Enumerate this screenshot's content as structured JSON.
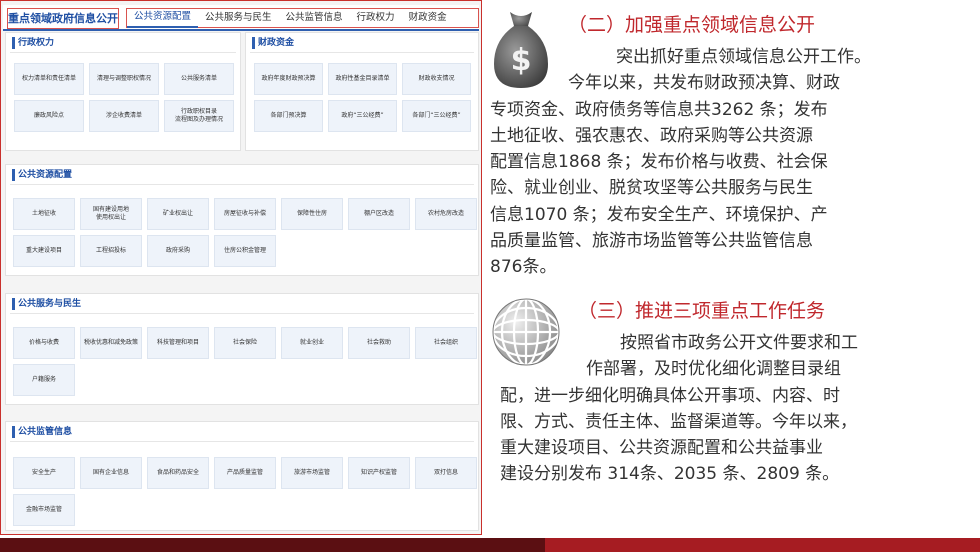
{
  "left_panel": {
    "site_title": "重点领域政府信息公开",
    "tabs": [
      "公共资源配置",
      "公共服务与民生",
      "公共监管信息",
      "行政权力",
      "财政资金"
    ],
    "active_tab": 0,
    "sections": {
      "admin_power": {
        "title": "行政权力",
        "items": [
          "权力清单和责任清单",
          "清理与调整职权情况",
          "公共服务清单",
          "廉政风险点",
          "涉企收费清单",
          "行政职权目录\n流程图及办理情况"
        ]
      },
      "fiscal": {
        "title": "财政资金",
        "items": [
          "政府年度财政预决算",
          "政府性基金目录清单",
          "财政收支情况",
          "各部门预决算",
          "政府“三公经费”",
          "各部门“三公经费”"
        ]
      },
      "resources": {
        "title": "公共资源配置",
        "items": [
          "土地征收",
          "国有建设用地\n使用权出让",
          "矿业权出让",
          "房屋征收与补偿",
          "保障性住房",
          "棚户区改造",
          "农村危房改造",
          "重大建设项目",
          "工程招投标",
          "政府采购",
          "住房公积金管理"
        ]
      },
      "services": {
        "title": "公共服务与民生",
        "items": [
          "价格与收费",
          "税收优惠和减免政策",
          "科技管理和项目",
          "社会保险",
          "就业创业",
          "社会救助",
          "社会组织",
          "户籍服务"
        ]
      },
      "supervision": {
        "title": "公共监管信息",
        "items": [
          "安全生产",
          "国有企业信息",
          "食品和药品安全",
          "产品质量监管",
          "旅游市场监管",
          "知识产权监管",
          "双打信息",
          "金融市场监管"
        ]
      }
    }
  },
  "right_panel": {
    "heading_2": "（二）加强重点领域信息公开",
    "para_2_lines": [
      "突出抓好重点领域信息公开工作。",
      "今年以来，共发布财政预决算、财政",
      "专项资金、政府债务等信息共3262 条；发布",
      "土地征收、强农惠农、政府采购等公共资源",
      "配置信息1868 条；发布价格与收费、社会保",
      "险、就业创业、脱贫攻坚等公共服务与民生",
      "信息1070 条；发布安全生产、环境保护、产",
      "品质量监管、旅游市场监管等公共监管信息",
      "876条。"
    ],
    "heading_3": "（三）推进三项重点工作任务",
    "para_3_lines": [
      "按照省市政务公开文件要求和工",
      "作部署，及时优化细化调整目录组",
      "配，进一步细化明确具体公开事项、内容、时",
      "限、方式、责任主体、监督渠道等。今年以来，",
      "重大建设项目、公共资源配置和公共益事业",
      "建设分别发布 314条、2035 条、2809 条。"
    ],
    "icons": [
      "money-bag-icon",
      "globe-icon"
    ],
    "money_symbol": "$"
  },
  "colors": {
    "heading": "#c0282d",
    "nav_blue": "#1f4fa3",
    "bottom_dark": "#5b0f12",
    "bottom_red": "#a61c22"
  }
}
